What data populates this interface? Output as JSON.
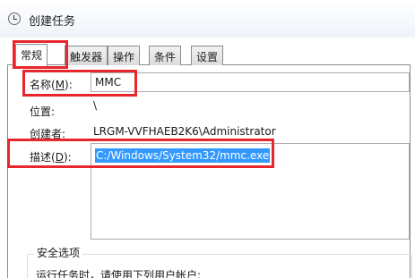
{
  "window": {
    "title": "创建任务",
    "icon": "task-clock-icon"
  },
  "tabs": [
    {
      "label": "常规",
      "active": true
    },
    {
      "label": "触发器"
    },
    {
      "label": "操作"
    },
    {
      "label": "条件"
    },
    {
      "label": "设置"
    }
  ],
  "general": {
    "name_label": "名称(",
    "name_hotkey": "M",
    "name_label_end": "):",
    "name_value": "MMC",
    "location_label": "位置:",
    "location_value": "\\",
    "author_label": "创建者:",
    "author_value": "LRGM-VVFHAEB2K6\\Administrator",
    "description_label": "描述(",
    "description_hotkey": "D",
    "description_label_end": "):",
    "description_value": "C:/Windows/System32/mmc.exe"
  },
  "security": {
    "group_title": "安全选项",
    "run_as_text": "运行任务时，请使用下列用户帐户:"
  },
  "highlight_color": "#e8272d",
  "selection_color": "#3399ff"
}
